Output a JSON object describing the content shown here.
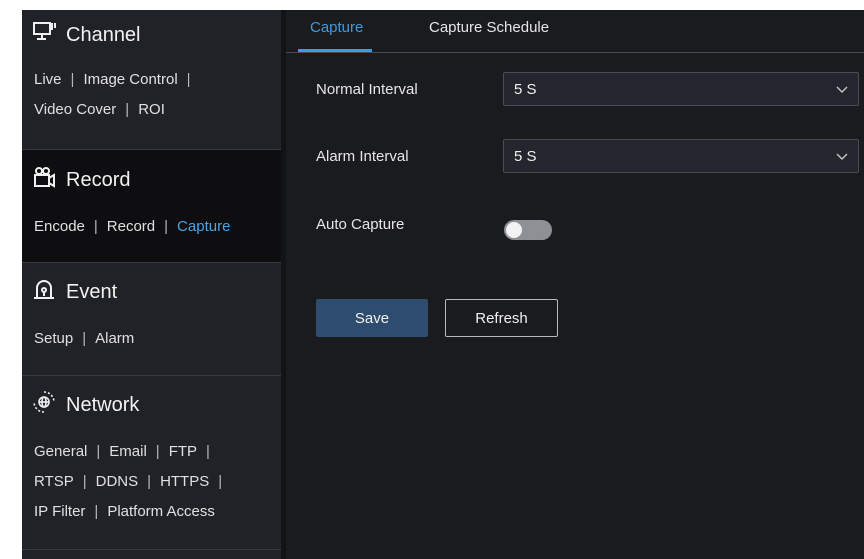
{
  "sidebar": {
    "channel": {
      "title": "Channel",
      "icon": "monitor-icon",
      "links": [
        [
          "Live",
          "Image Control"
        ],
        [
          "Video Cover",
          "ROI"
        ]
      ]
    },
    "record": {
      "title": "Record",
      "icon": "camera-record-icon",
      "links": [
        [
          "Encode",
          "Record",
          "Capture"
        ]
      ],
      "current": "Capture"
    },
    "event": {
      "title": "Event",
      "icon": "alarm-light-icon",
      "links": [
        [
          "Setup",
          "Alarm"
        ]
      ]
    },
    "network": {
      "title": "Network",
      "icon": "globe-network-icon",
      "links": [
        [
          "General",
          "Email",
          "FTP"
        ],
        [
          "RTSP",
          "DDNS",
          "HTTPS"
        ],
        [
          "IP Filter",
          "Platform Access"
        ]
      ]
    }
  },
  "tabs": [
    {
      "label": "Capture",
      "active": true
    },
    {
      "label": "Capture Schedule",
      "active": false
    }
  ],
  "form": {
    "normal_interval": {
      "label": "Normal Interval",
      "value": "5 S"
    },
    "alarm_interval": {
      "label": "Alarm Interval",
      "value": "5 S"
    },
    "auto_capture": {
      "label": "Auto Capture",
      "enabled": false
    }
  },
  "buttons": {
    "save": "Save",
    "refresh": "Refresh"
  },
  "colors": {
    "accent": "#3d9be0",
    "save_button": "#2e4d6e",
    "background": "#1a1b1f"
  }
}
